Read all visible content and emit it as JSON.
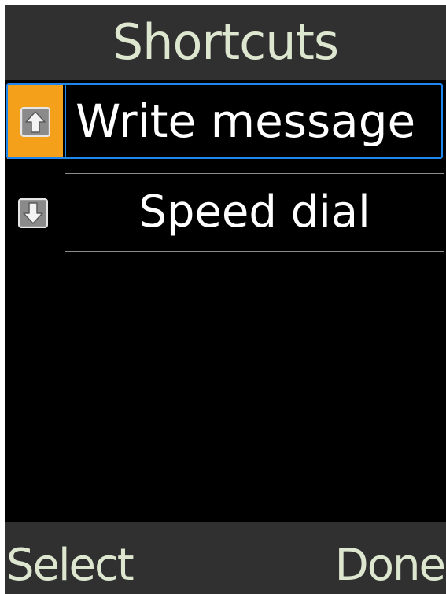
{
  "header": {
    "title": "Shortcuts"
  },
  "shortcuts": [
    {
      "label": "Write message",
      "icon": "move-up-arrow-icon",
      "selected": true
    },
    {
      "label": "Speed dial",
      "icon": "move-down-arrow-icon",
      "selected": false
    }
  ],
  "softkeys": {
    "left": "Select",
    "right": "Done"
  },
  "colors": {
    "background": "#000000",
    "bar": "#303030",
    "bar_text": "#dde6cf",
    "accent_orange": "#f5a01a",
    "focus_blue": "#1f86ee",
    "item_border": "#8c8c8c",
    "item_text": "#ffffff"
  }
}
